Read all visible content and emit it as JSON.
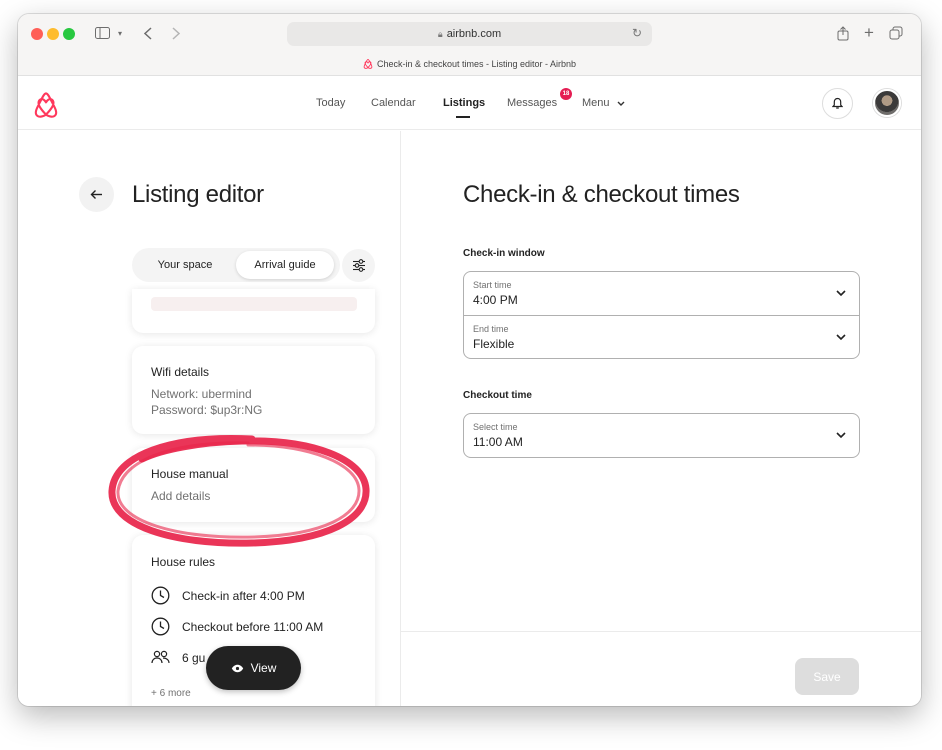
{
  "browser": {
    "url": "airbnb.com",
    "tab_title": "Check-in & checkout times - Listing editor - Airbnb"
  },
  "nav": {
    "items": [
      {
        "label": "Today"
      },
      {
        "label": "Calendar"
      },
      {
        "label": "Listings"
      },
      {
        "label": "Messages"
      },
      {
        "label": "Menu"
      }
    ],
    "active": "Listings",
    "messages_badge": "18"
  },
  "left": {
    "title": "Listing editor",
    "segments": [
      "Your space",
      "Arrival guide"
    ],
    "active_segment": "Arrival guide",
    "wifi": {
      "title": "Wifi details",
      "network": "Network: ubermind",
      "password": "Password: $up3r:NG"
    },
    "manual": {
      "title": "House manual",
      "text": "Add details"
    },
    "rules": {
      "title": "House rules",
      "items": [
        {
          "icon": "clock-icon",
          "text": "Check-in after 4:00 PM"
        },
        {
          "icon": "clock-icon",
          "text": "Checkout before 11:00 AM"
        },
        {
          "icon": "guests-icon",
          "text": "6 gu"
        }
      ],
      "more": "+ 6 more"
    },
    "view_button": "View"
  },
  "right": {
    "title": "Check-in & checkout times",
    "checkin_label": "Check-in window",
    "start": {
      "label": "Start time",
      "value": "4:00 PM"
    },
    "end": {
      "label": "End time",
      "value": "Flexible"
    },
    "checkout_label": "Checkout time",
    "checkout": {
      "label": "Select time",
      "value": "11:00 AM"
    },
    "save": "Save"
  },
  "colors": {
    "brand": "#ff385c",
    "annotation": "#e8244a",
    "text": "#222222",
    "muted": "#717171"
  }
}
